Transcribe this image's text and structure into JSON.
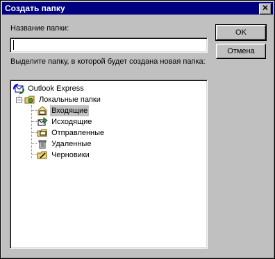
{
  "window": {
    "title": "Создать папку"
  },
  "title_bar": {
    "close_symbol": "✕"
  },
  "form": {
    "folder_name_label": "Название папки:",
    "folder_name_value": "",
    "instruction": "Выделите папку, в которой будет создана новая папка:"
  },
  "buttons": {
    "ok_label": "OK",
    "cancel_label": "Отмена"
  },
  "tree": {
    "root": "Outlook Express",
    "local": "Локальные папки",
    "folders": [
      "Входящие",
      "Исходящие",
      "Отправленные",
      "Удаленные",
      "Черновики"
    ],
    "selected": "Входящие"
  },
  "colors": {
    "titlebar": "#000080",
    "face": "#c0c0c0",
    "selection": "#c0c0c0"
  }
}
